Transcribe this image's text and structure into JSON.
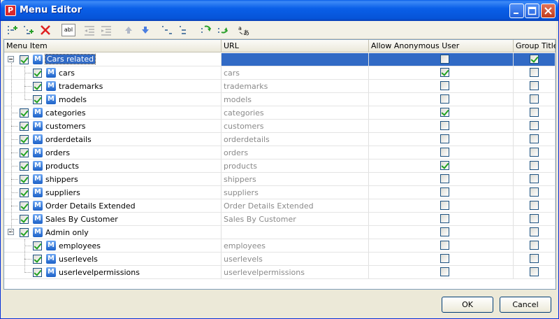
{
  "window": {
    "title": "Menu Editor",
    "app_icon_letter": "P"
  },
  "columns": [
    "Menu Item",
    "URL",
    "Allow Anonymous User",
    "Group Title"
  ],
  "rows": [
    {
      "name": "Cars related",
      "url": "",
      "anon": false,
      "group": true,
      "level": 0,
      "expanded": true,
      "selected": true
    },
    {
      "name": "cars",
      "url": "cars",
      "anon": true,
      "group": false,
      "level": 1
    },
    {
      "name": "trademarks",
      "url": "trademarks",
      "anon": false,
      "group": false,
      "level": 1
    },
    {
      "name": "models",
      "url": "models",
      "anon": false,
      "group": false,
      "level": 1
    },
    {
      "name": "categories",
      "url": "categories",
      "anon": true,
      "group": false,
      "level": 0
    },
    {
      "name": "customers",
      "url": "customers",
      "anon": false,
      "group": false,
      "level": 0
    },
    {
      "name": "orderdetails",
      "url": "orderdetails",
      "anon": false,
      "group": false,
      "level": 0
    },
    {
      "name": "orders",
      "url": "orders",
      "anon": false,
      "group": false,
      "level": 0
    },
    {
      "name": "products",
      "url": "products",
      "anon": true,
      "group": false,
      "level": 0
    },
    {
      "name": "shippers",
      "url": "shippers",
      "anon": false,
      "group": false,
      "level": 0
    },
    {
      "name": "suppliers",
      "url": "suppliers",
      "anon": false,
      "group": false,
      "level": 0
    },
    {
      "name": "Order Details Extended",
      "url": "Order Details Extended",
      "anon": false,
      "group": false,
      "level": 0
    },
    {
      "name": "Sales By Customer",
      "url": "Sales By Customer",
      "anon": false,
      "group": false,
      "level": 0
    },
    {
      "name": "Admin only",
      "url": "",
      "anon": false,
      "group": false,
      "level": 0,
      "expanded": true
    },
    {
      "name": "employees",
      "url": "employees",
      "anon": false,
      "group": false,
      "level": 1
    },
    {
      "name": "userlevels",
      "url": "userlevels",
      "anon": false,
      "group": false,
      "level": 1
    },
    {
      "name": "userlevelpermissions",
      "url": "userlevelpermissions",
      "anon": false,
      "group": false,
      "level": 1
    }
  ],
  "menu_item_icon_letter": "M",
  "buttons": {
    "ok": "OK",
    "cancel": "Cancel"
  },
  "toolbar_rename_label": "abl",
  "colors": {
    "titlebar": "#0a5fe8",
    "selection": "#316ac5",
    "check": "#21a121"
  }
}
